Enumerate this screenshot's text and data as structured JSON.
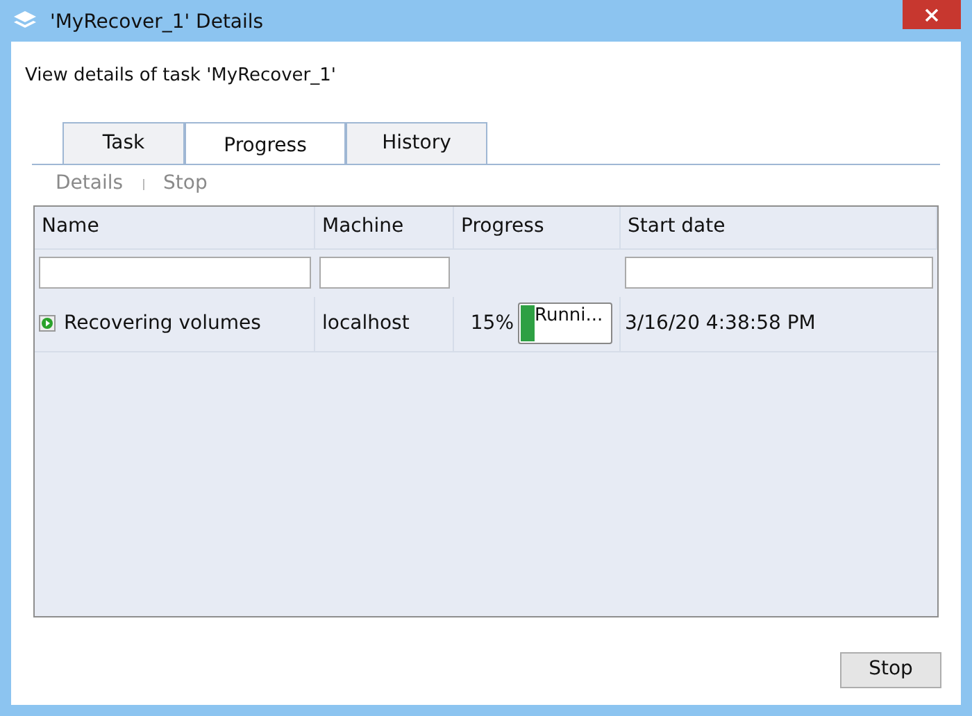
{
  "window": {
    "title": "'MyRecover_1' Details"
  },
  "description": "View details of task 'MyRecover_1'",
  "tabs": [
    {
      "label": "Task",
      "selected": false
    },
    {
      "label": "Progress",
      "selected": true
    },
    {
      "label": "History",
      "selected": false
    }
  ],
  "toolbar": [
    {
      "label": "Details",
      "disabled": true
    },
    {
      "label": "Stop",
      "disabled": true
    }
  ],
  "table": {
    "columns": [
      "Name",
      "Machine",
      "Progress",
      "Start date"
    ],
    "filters": [
      true,
      true,
      false,
      true
    ],
    "rows": [
      {
        "name": "Recovering volumes",
        "machine": "localhost",
        "percent": "15%",
        "level": 0.15,
        "status": "Runni...",
        "start_date": "3/16/20 4:38:58 PM"
      }
    ]
  },
  "buttons": [
    "Stop"
  ]
}
